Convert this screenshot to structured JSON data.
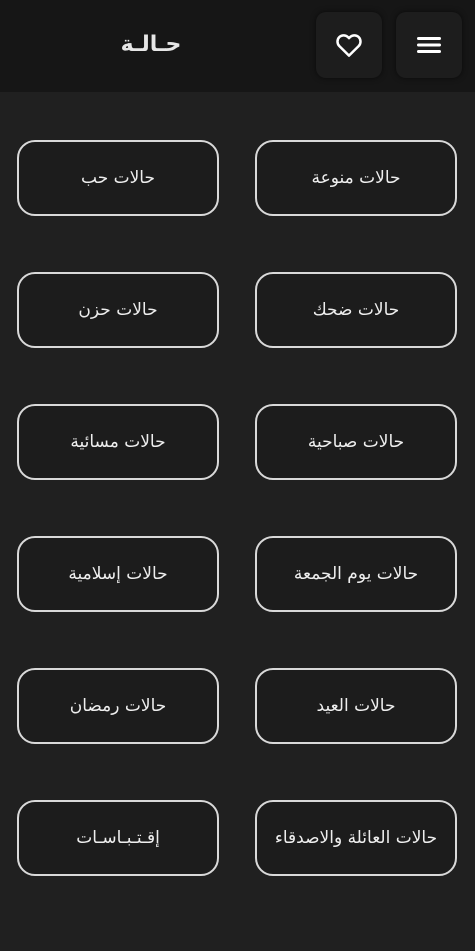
{
  "header": {
    "title": "حـالـة",
    "favorites_icon": "heart-outline-icon",
    "menu_icon": "hamburger-menu-icon"
  },
  "categories": [
    {
      "label": "حالات منوعة"
    },
    {
      "label": "حالات حب"
    },
    {
      "label": "حالات ضحك"
    },
    {
      "label": "حالات حزن"
    },
    {
      "label": "حالات صباحية"
    },
    {
      "label": "حالات مسائية"
    },
    {
      "label": "حالات يوم الجمعة"
    },
    {
      "label": "حالات إسلامية"
    },
    {
      "label": "حالات العيد"
    },
    {
      "label": "حالات رمضان"
    },
    {
      "label": "حالات العائلة والاصدقاء"
    },
    {
      "label": "إقـتـبـاسـات"
    }
  ],
  "colors": {
    "background": "#202020",
    "topbar": "#161616",
    "button_border": "#d9d9d9",
    "text": "#eeeeee"
  }
}
